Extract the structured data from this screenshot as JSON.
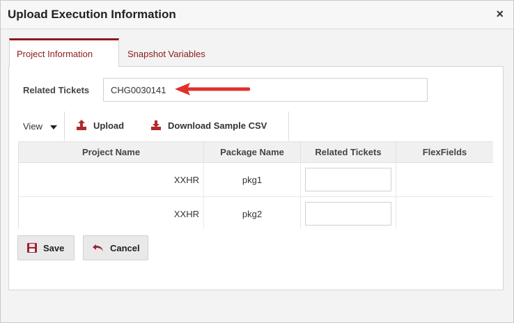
{
  "dialog": {
    "title": "Upload Execution Information",
    "close_glyph": "×"
  },
  "tabs": [
    {
      "label": "Project Information",
      "active": true
    },
    {
      "label": "Snapshot Variables",
      "active": false
    }
  ],
  "related_tickets": {
    "label": "Related Tickets",
    "value": "CHG0030141"
  },
  "toolbar": {
    "view_label": "View",
    "upload_label": "Upload",
    "download_label": "Download Sample CSV"
  },
  "table": {
    "columns": [
      "Project Name",
      "Package Name",
      "Related Tickets",
      "FlexFields"
    ],
    "rows": [
      {
        "project_name": "XXHR",
        "package_name": "pkg1",
        "related_tickets": "",
        "flexfields": ""
      },
      {
        "project_name": "XXHR",
        "package_name": "pkg2",
        "related_tickets": "",
        "flexfields": ""
      }
    ]
  },
  "buttons": {
    "save_label": "Save",
    "cancel_label": "Cancel"
  },
  "colors": {
    "accent": "#8b1a1a",
    "arrow": "#e0302a"
  }
}
